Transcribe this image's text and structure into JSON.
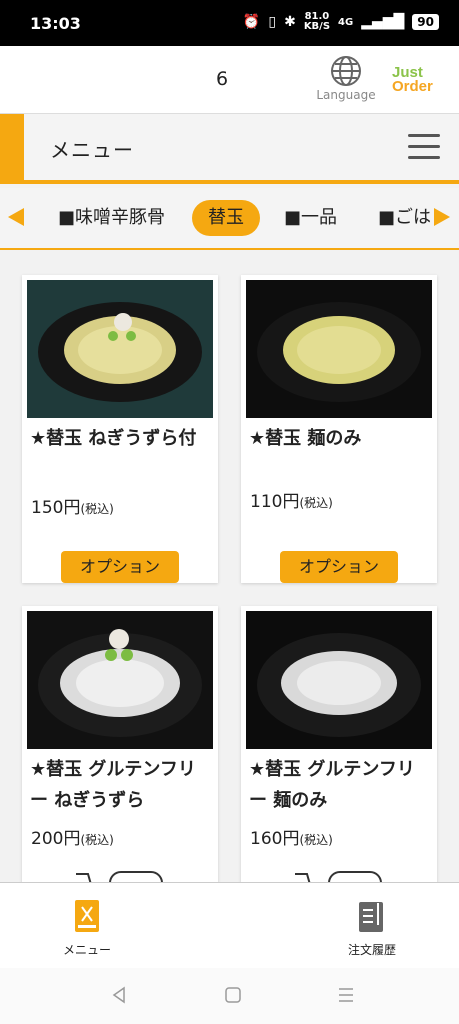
{
  "status_bar": {
    "time": "13:03",
    "speed_value": "81.0",
    "speed_unit": "KB/S",
    "network": "4G",
    "battery": "90"
  },
  "header": {
    "table_number": "6",
    "language_label": "Language",
    "logo_line1": "Just",
    "logo_line2": "Order"
  },
  "titlebar": {
    "title": "メニュー"
  },
  "categories": [
    {
      "label": "■味噌辛豚骨",
      "active": false
    },
    {
      "label": "替玉",
      "active": true
    },
    {
      "label": "■一品",
      "active": false
    },
    {
      "label": "■ごは",
      "active": false
    }
  ],
  "products": [
    {
      "name": "★替玉 ねぎうずら付",
      "price": "150円",
      "tax": "(税込)",
      "button": "オプション"
    },
    {
      "name": "★替玉 麺のみ",
      "price": "110円",
      "tax": "(税込)",
      "button": "オプション"
    },
    {
      "name": "★替玉 グルテンフリー ねぎうずら",
      "price": "200円",
      "tax": "(税込)",
      "button": ""
    },
    {
      "name": "★替玉 グルテンフリー 麺のみ",
      "price": "160円",
      "tax": "(税込)",
      "button": ""
    }
  ],
  "bottom_nav": {
    "menu_label": "メニュー",
    "history_label": "注文履歴"
  },
  "colors": {
    "accent": "#f5a811",
    "logo_green": "#8bc34a"
  }
}
